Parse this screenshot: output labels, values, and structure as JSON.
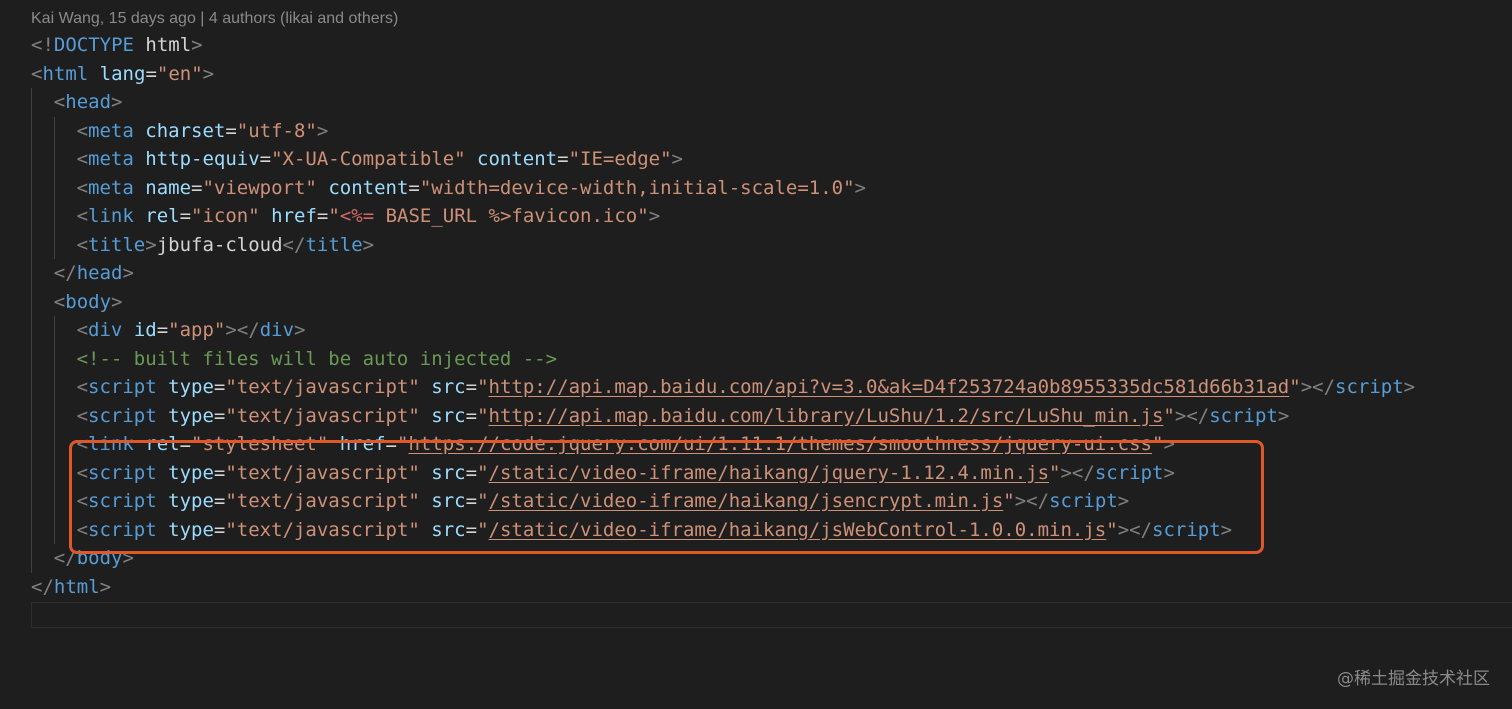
{
  "codelens": "Kai Wang, 15 days ago | 4 authors (likai and others)",
  "lines": [
    {
      "indent": 0,
      "tokens": [
        [
          "punc",
          "<!"
        ],
        [
          "tag",
          "DOCTYPE"
        ],
        [
          "txt",
          " html"
        ],
        [
          "punc",
          ">"
        ]
      ]
    },
    {
      "indent": 0,
      "tokens": [
        [
          "punc",
          "<"
        ],
        [
          "tag",
          "html"
        ],
        [
          "txt",
          " "
        ],
        [
          "attr",
          "lang"
        ],
        [
          "txt",
          "="
        ],
        [
          "str",
          "\"en\""
        ],
        [
          "punc",
          ">"
        ]
      ]
    },
    {
      "indent": 1,
      "tokens": [
        [
          "punc",
          "<"
        ],
        [
          "tag",
          "head"
        ],
        [
          "punc",
          ">"
        ]
      ]
    },
    {
      "indent": 2,
      "tokens": [
        [
          "punc",
          "<"
        ],
        [
          "tag",
          "meta"
        ],
        [
          "txt",
          " "
        ],
        [
          "attr",
          "charset"
        ],
        [
          "txt",
          "="
        ],
        [
          "str",
          "\"utf-8\""
        ],
        [
          "punc",
          ">"
        ]
      ]
    },
    {
      "indent": 2,
      "tokens": [
        [
          "punc",
          "<"
        ],
        [
          "tag",
          "meta"
        ],
        [
          "txt",
          " "
        ],
        [
          "attr",
          "http-equiv"
        ],
        [
          "txt",
          "="
        ],
        [
          "str",
          "\"X-UA-Compatible\""
        ],
        [
          "txt",
          " "
        ],
        [
          "attr",
          "content"
        ],
        [
          "txt",
          "="
        ],
        [
          "str",
          "\"IE=edge\""
        ],
        [
          "punc",
          ">"
        ]
      ]
    },
    {
      "indent": 2,
      "tokens": [
        [
          "punc",
          "<"
        ],
        [
          "tag",
          "meta"
        ],
        [
          "txt",
          " "
        ],
        [
          "attr",
          "name"
        ],
        [
          "txt",
          "="
        ],
        [
          "str",
          "\"viewport\""
        ],
        [
          "txt",
          " "
        ],
        [
          "attr",
          "content"
        ],
        [
          "txt",
          "="
        ],
        [
          "str",
          "\"width=device-width,initial-scale=1.0\""
        ],
        [
          "punc",
          ">"
        ]
      ]
    },
    {
      "indent": 2,
      "tokens": [
        [
          "punc",
          "<"
        ],
        [
          "tag",
          "link"
        ],
        [
          "txt",
          " "
        ],
        [
          "attr",
          "rel"
        ],
        [
          "txt",
          "="
        ],
        [
          "str",
          "\"icon\""
        ],
        [
          "txt",
          " "
        ],
        [
          "attr",
          "href"
        ],
        [
          "txt",
          "="
        ],
        [
          "str",
          "\""
        ],
        [
          "tmpl",
          "<%="
        ],
        [
          "str",
          " BASE_URL %>favicon.ico\""
        ],
        [
          "punc",
          ">"
        ]
      ]
    },
    {
      "indent": 2,
      "tokens": [
        [
          "punc",
          "<"
        ],
        [
          "tag",
          "title"
        ],
        [
          "punc",
          ">"
        ],
        [
          "txt",
          "jbufa-cloud"
        ],
        [
          "punc",
          "</"
        ],
        [
          "tag",
          "title"
        ],
        [
          "punc",
          ">"
        ]
      ]
    },
    {
      "indent": 1,
      "tokens": [
        [
          "punc",
          "</"
        ],
        [
          "tag",
          "head"
        ],
        [
          "punc",
          ">"
        ]
      ]
    },
    {
      "indent": 1,
      "tokens": [
        [
          "punc",
          "<"
        ],
        [
          "tag",
          "body"
        ],
        [
          "punc",
          ">"
        ]
      ]
    },
    {
      "indent": 2,
      "tokens": [
        [
          "punc",
          "<"
        ],
        [
          "tag",
          "div"
        ],
        [
          "txt",
          " "
        ],
        [
          "attr",
          "id"
        ],
        [
          "txt",
          "="
        ],
        [
          "str",
          "\"app\""
        ],
        [
          "punc",
          "></"
        ],
        [
          "tag",
          "div"
        ],
        [
          "punc",
          ">"
        ]
      ]
    },
    {
      "indent": 2,
      "tokens": [
        [
          "cmt",
          "<!-- built files will be auto injected -->"
        ]
      ]
    },
    {
      "indent": 2,
      "tokens": [
        [
          "punc",
          "<"
        ],
        [
          "tag",
          "script"
        ],
        [
          "txt",
          " "
        ],
        [
          "attr",
          "type"
        ],
        [
          "txt",
          "="
        ],
        [
          "str",
          "\"text/javascript\""
        ],
        [
          "txt",
          " "
        ],
        [
          "attr",
          "src"
        ],
        [
          "txt",
          "="
        ],
        [
          "str",
          "\""
        ],
        [
          "url",
          "http://api.map.baidu.com/api?v=3.0&ak=D4f253724a0b8955335dc581d66b31ad"
        ],
        [
          "str",
          "\""
        ],
        [
          "punc",
          "></"
        ],
        [
          "tag",
          "script"
        ],
        [
          "punc",
          ">"
        ]
      ]
    },
    {
      "indent": 2,
      "tokens": [
        [
          "punc",
          "<"
        ],
        [
          "tag",
          "script"
        ],
        [
          "txt",
          " "
        ],
        [
          "attr",
          "type"
        ],
        [
          "txt",
          "="
        ],
        [
          "str",
          "\"text/javascript\""
        ],
        [
          "txt",
          " "
        ],
        [
          "attr",
          "src"
        ],
        [
          "txt",
          "="
        ],
        [
          "str",
          "\""
        ],
        [
          "url",
          "http://api.map.baidu.com/library/LuShu/1.2/src/LuShu_min.js"
        ],
        [
          "str",
          "\""
        ],
        [
          "punc",
          "></"
        ],
        [
          "tag",
          "script"
        ],
        [
          "punc",
          ">"
        ]
      ]
    },
    {
      "indent": 2,
      "tokens": [
        [
          "punc",
          "<"
        ],
        [
          "tag",
          "link"
        ],
        [
          "txt",
          " "
        ],
        [
          "attr",
          "rel"
        ],
        [
          "txt",
          "="
        ],
        [
          "str",
          "\"stylesheet\""
        ],
        [
          "txt",
          " "
        ],
        [
          "attr",
          "href"
        ],
        [
          "txt",
          "="
        ],
        [
          "str",
          "\""
        ],
        [
          "url",
          "https://code.jquery.com/ui/1.11.1/themes/smoothness/jquery-ui.css"
        ],
        [
          "str",
          "\""
        ],
        [
          "punc",
          ">"
        ]
      ]
    },
    {
      "indent": 2,
      "tokens": [
        [
          "punc",
          "<"
        ],
        [
          "tag",
          "script"
        ],
        [
          "txt",
          " "
        ],
        [
          "attr",
          "type"
        ],
        [
          "txt",
          "="
        ],
        [
          "str",
          "\"text/javascript\""
        ],
        [
          "txt",
          " "
        ],
        [
          "attr",
          "src"
        ],
        [
          "txt",
          "="
        ],
        [
          "str",
          "\""
        ],
        [
          "url",
          "/static/video-iframe/haikang/jquery-1.12.4.min.js"
        ],
        [
          "str",
          "\""
        ],
        [
          "punc",
          "></"
        ],
        [
          "tag",
          "script"
        ],
        [
          "punc",
          ">"
        ]
      ]
    },
    {
      "indent": 2,
      "tokens": [
        [
          "punc",
          "<"
        ],
        [
          "tag",
          "script"
        ],
        [
          "txt",
          " "
        ],
        [
          "attr",
          "type"
        ],
        [
          "txt",
          "="
        ],
        [
          "str",
          "\"text/javascript\""
        ],
        [
          "txt",
          " "
        ],
        [
          "attr",
          "src"
        ],
        [
          "txt",
          "="
        ],
        [
          "str",
          "\""
        ],
        [
          "url",
          "/static/video-iframe/haikang/jsencrypt.min.js"
        ],
        [
          "str",
          "\""
        ],
        [
          "punc",
          "></"
        ],
        [
          "tag",
          "script"
        ],
        [
          "punc",
          ">"
        ]
      ]
    },
    {
      "indent": 2,
      "tokens": [
        [
          "punc",
          "<"
        ],
        [
          "tag",
          "script"
        ],
        [
          "txt",
          " "
        ],
        [
          "attr",
          "type"
        ],
        [
          "txt",
          "="
        ],
        [
          "str",
          "\"text/javascript\""
        ],
        [
          "txt",
          " "
        ],
        [
          "attr",
          "src"
        ],
        [
          "txt",
          "="
        ],
        [
          "str",
          "\""
        ],
        [
          "url",
          "/static/video-iframe/haikang/jsWebControl-1.0.0.min.js"
        ],
        [
          "str",
          "\""
        ],
        [
          "punc",
          "></"
        ],
        [
          "tag",
          "script"
        ],
        [
          "punc",
          ">"
        ]
      ]
    },
    {
      "indent": 1,
      "tokens": [
        [
          "punc",
          "</"
        ],
        [
          "tag",
          "body"
        ],
        [
          "punc",
          ">"
        ]
      ]
    },
    {
      "indent": 0,
      "tokens": [
        [
          "punc",
          "</"
        ],
        [
          "tag",
          "html"
        ],
        [
          "punc",
          ">"
        ]
      ]
    }
  ],
  "watermark": "@稀土掘金技术社区",
  "colors": {
    "background": "#1e1e1e",
    "tag": "#569cd6",
    "attribute": "#9cdcfe",
    "string": "#ce9178",
    "comment": "#6a9955",
    "highlight_border": "#e0582a"
  }
}
